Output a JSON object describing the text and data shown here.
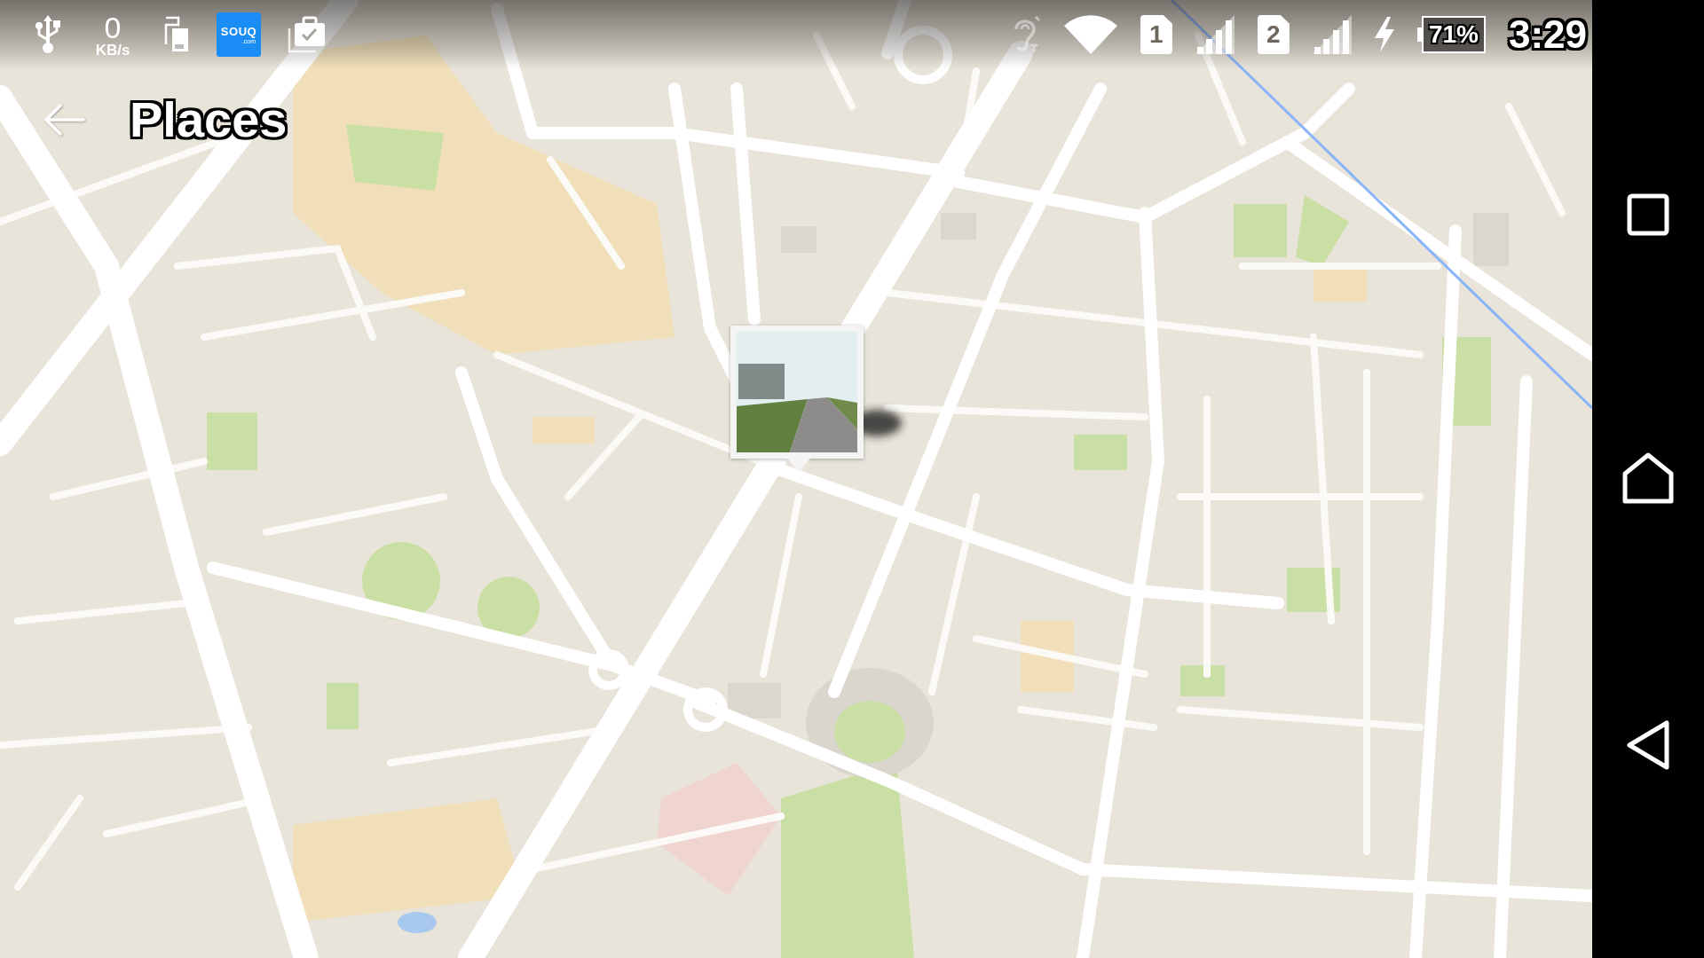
{
  "status_bar": {
    "network_speed": {
      "value": "0",
      "unit": "KB/s"
    },
    "app_logo": {
      "name": "SOUQ",
      "domain": ".com"
    },
    "sims": [
      {
        "label": "1"
      },
      {
        "label": "2"
      }
    ],
    "charging": true,
    "battery": "71%",
    "time": "3:29"
  },
  "app_bar": {
    "title": "Places"
  },
  "map": {
    "markers": [
      {
        "kind": "photo"
      }
    ]
  }
}
